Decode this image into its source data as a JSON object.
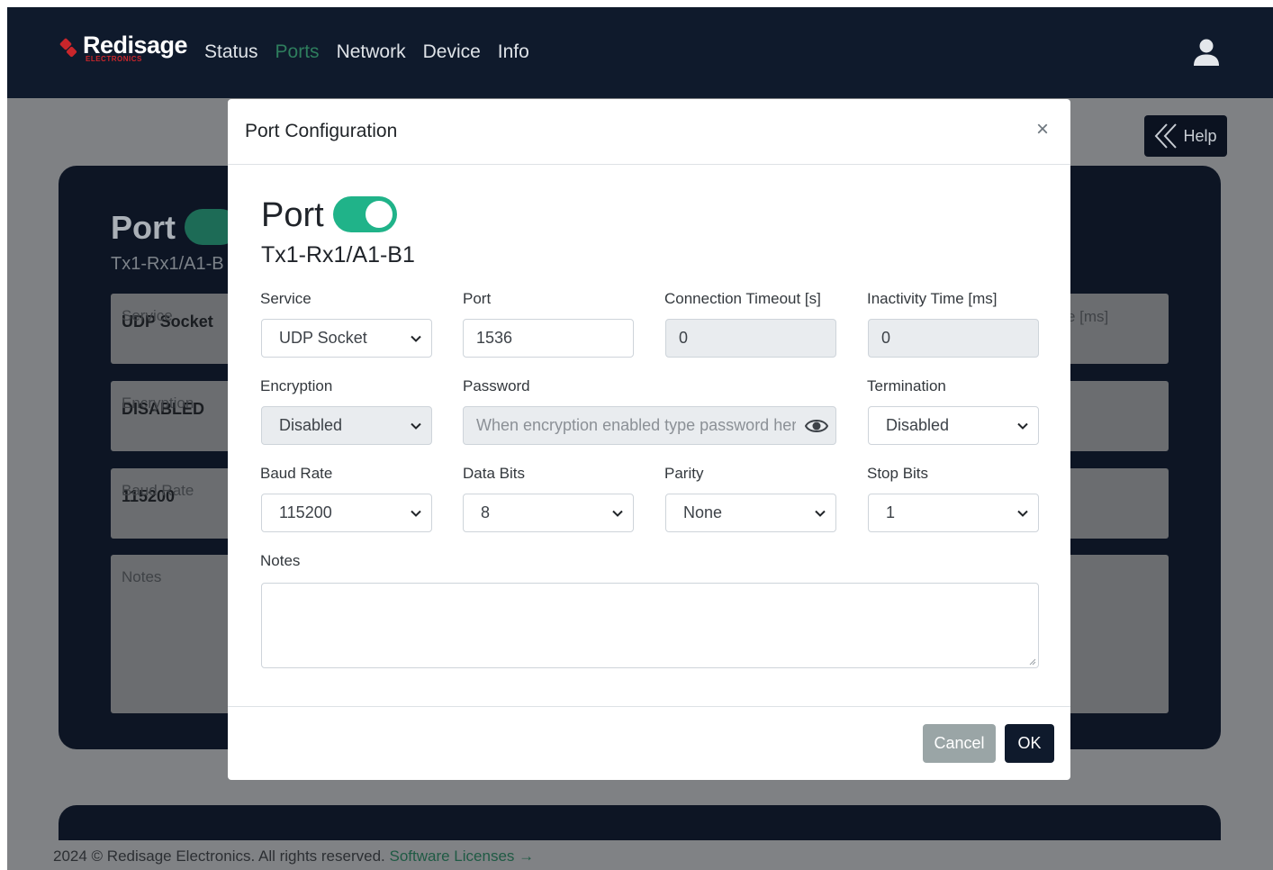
{
  "navbar": {
    "brand_name": "Redisage",
    "brand_sub": "ELECTRONICS",
    "links": [
      "Status",
      "Ports",
      "Network",
      "Device",
      "Info"
    ],
    "active_link": "Ports",
    "active_color": "#2e7d5d",
    "user_icon": "user-icon"
  },
  "background": {
    "help_label": "Help",
    "help_icon": "double-chevron-left-icon",
    "port_title": "Port",
    "port_subtitle": "Tx1-Rx1/A1-B",
    "fields": [
      {
        "label": "Service",
        "value": "UDP Socket"
      },
      {
        "label": "Encryption",
        "value": "DISABLED"
      },
      {
        "label": "Baud Rate",
        "value": "115200"
      },
      {
        "label": "Notes",
        "value": ""
      }
    ],
    "right_partial_label": "e [ms]"
  },
  "modal": {
    "title": "Port Configuration",
    "close_icon": "×",
    "port_heading": "Port",
    "port_enabled": true,
    "port_name": "Tx1-Rx1/A1-B1",
    "fields": {
      "service": {
        "label": "Service",
        "value": "UDP Socket"
      },
      "port": {
        "label": "Port",
        "value": "1536"
      },
      "connection_timeout": {
        "label": "Connection Timeout [s]",
        "value": "0"
      },
      "inactivity_time": {
        "label": "Inactivity Time [ms]",
        "value": "0"
      },
      "encryption": {
        "label": "Encryption",
        "value": "Disabled"
      },
      "password": {
        "label": "Password",
        "placeholder": "When encryption enabled type password here"
      },
      "termination": {
        "label": "Termination",
        "value": "Disabled"
      },
      "baud_rate": {
        "label": "Baud Rate",
        "value": "115200"
      },
      "data_bits": {
        "label": "Data Bits",
        "value": "8"
      },
      "parity": {
        "label": "Parity",
        "value": "None"
      },
      "stop_bits": {
        "label": "Stop Bits",
        "value": "1"
      },
      "notes": {
        "label": "Notes",
        "value": ""
      }
    },
    "cancel_label": "Cancel",
    "ok_label": "OK",
    "toggle_color": "#20b389"
  },
  "footer": {
    "text": "2024 © Redisage Electronics. All rights reserved.",
    "link_text": "Software Licenses →"
  }
}
